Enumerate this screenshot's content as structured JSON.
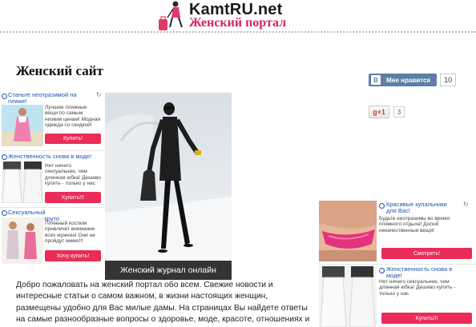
{
  "header": {
    "site_title": "KamtRU.net",
    "site_subtitle": "Женский портал"
  },
  "page_title": "Женский сайт",
  "social": {
    "vk_label": "Мне нравится",
    "vk_logo": "В",
    "vk_count": "10",
    "gplus_label": "g+1",
    "gplus_count": "3"
  },
  "left_ads": [
    {
      "title": "Станьте неотразимой на пляже!",
      "text": "Лучшие пляжные вещи по самым низким ценам! Модная одежда со скидкой!",
      "button": "Купить!"
    },
    {
      "title": "Женственность снова в моде!",
      "text": "Нет ничего сексуальнее, чем длинная юбка! Дешево купить - только у нас",
      "button": "Купить!!!"
    },
    {
      "title": "Сексуальный костюм - это круто",
      "text": "Пляжный костюм привлечет внимание всех мужчин! Они не пройдут мимо!!!",
      "button": "Хочу купить!"
    }
  ],
  "right_ads": [
    {
      "title": "Красивые купальники для Вас!",
      "text": "Будьте неотразимы во время пляжного отдыха! Долой некачественные вещи!",
      "button": "Смотреть!"
    },
    {
      "title": "Женственность снова в моде!",
      "text": "Нет ничего сексуальнее, чем длинная юбка! Дешево купить - только у нас",
      "button": "Купить!!!"
    }
  ],
  "main_photo_caption": "Женский журнал онлайн",
  "intro_text": "Добро пожаловать на женский портал обо всем. Свежие новости и интересные статьи о самом важном, в жизни настоящих женщин, размещены удобно для Вас милые дамы. На страницах Вы найдете ответы на самые разнообразные вопросы о здоровье, моде, красоте, отношениях и диетах."
}
